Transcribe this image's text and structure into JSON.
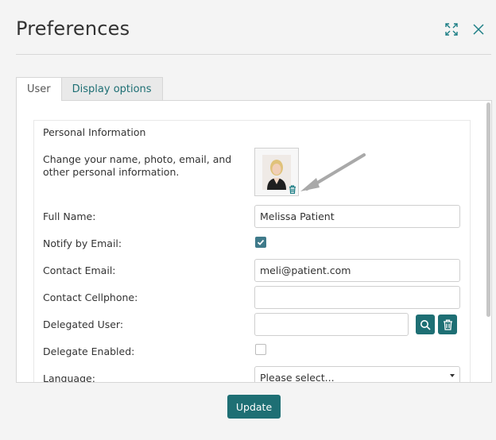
{
  "window": {
    "title": "Preferences"
  },
  "tabs": [
    {
      "label": "User",
      "active": true
    },
    {
      "label": "Display options",
      "active": false
    }
  ],
  "personal": {
    "section_title": "Personal Information",
    "description": "Change your name, photo, email, and other personal information."
  },
  "fields": {
    "full_name": {
      "label": "Full Name:",
      "value": "Melissa Patient"
    },
    "notify_email": {
      "label": "Notify by Email:",
      "checked": true
    },
    "contact_email": {
      "label": "Contact Email:",
      "value": "meli@patient.com"
    },
    "contact_cell": {
      "label": "Contact Cellphone:",
      "value": ""
    },
    "delegated_user": {
      "label": "Delegated User:",
      "value": ""
    },
    "delegate_enabled": {
      "label": "Delegate Enabled:",
      "checked": false
    },
    "language": {
      "label": "Language:",
      "selected": "Please select..."
    }
  },
  "footer": {
    "update_label": "Update"
  },
  "colors": {
    "accent": "#1e6f74",
    "checkbox_checked": "#3f7a8a"
  },
  "icons": [
    "expand-icon",
    "close-icon",
    "trash-icon",
    "search-icon",
    "check-icon",
    "chevron-down-icon"
  ]
}
